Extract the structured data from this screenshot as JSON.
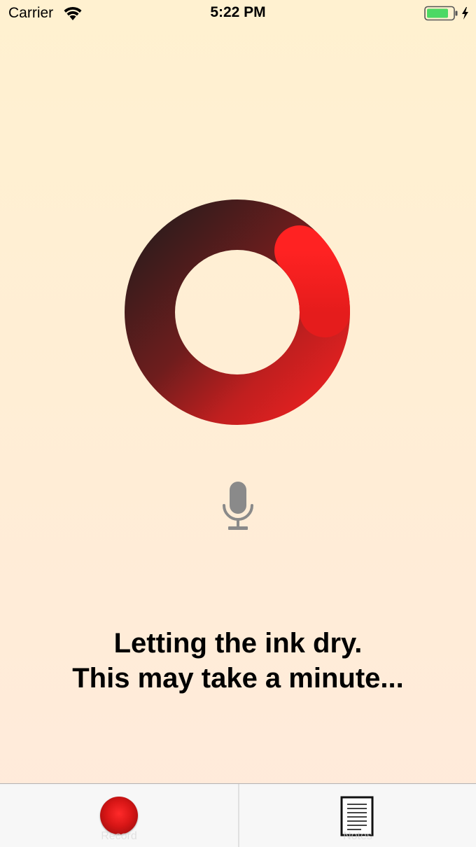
{
  "status_bar": {
    "carrier": "Carrier",
    "time": "5:22 PM",
    "icons": [
      "wifi-icon",
      "battery-icon",
      "charging-bolt-icon"
    ],
    "battery_color": "#4cd964"
  },
  "progress": {
    "icon": "progress-ring-icon",
    "gradient_colors": [
      "#2b1d1d",
      "#ff2020"
    ]
  },
  "mic": {
    "icon": "microphone-icon",
    "color": "#8a8a8a"
  },
  "message": {
    "line1": "Letting the ink dry.",
    "line2": "This may take a minute..."
  },
  "tab_bar": {
    "tabs": [
      {
        "label": "Record",
        "icon": "record-icon"
      },
      {
        "label": "Notes",
        "icon": "notes-icon"
      }
    ]
  }
}
